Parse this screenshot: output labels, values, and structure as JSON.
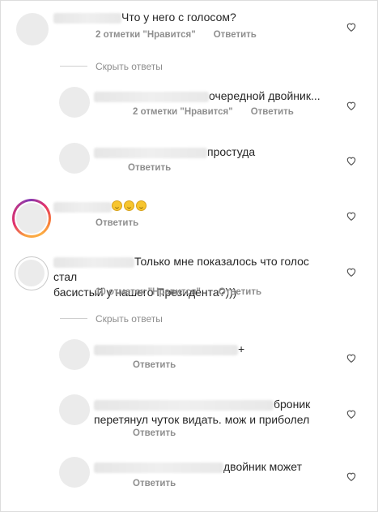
{
  "comments": [
    {
      "text": "Что у него с голосом?",
      "likes": "2 отметки \"Нравится\"",
      "reply": "Ответить"
    },
    {
      "hide_replies": "Скрыть ответы"
    },
    {
      "text": "очередной двойник...",
      "likes": "2 отметки \"Нравится\"",
      "reply": "Ответить"
    },
    {
      "text": "простуда",
      "reply": "Ответить"
    },
    {
      "emoji_count": 3,
      "reply": "Ответить"
    },
    {
      "text": "Только мне показалось что голос стал басистый у нашего Президента?)))",
      "likes": "10 отметок \"Нравится\"",
      "reply": "Ответить"
    },
    {
      "hide_replies": "Скрыть ответы"
    },
    {
      "text": "+",
      "reply": "Ответить"
    },
    {
      "text": "броник перетянул чуток видать. мож и приболел",
      "reply": "Ответить"
    },
    {
      "text": "двойник может",
      "reply": "Ответить"
    }
  ],
  "c1": {
    "text": "Что у него с голосом?",
    "likes": "2 отметки \"Нравится\"",
    "reply": "Ответить"
  },
  "h1": "Скрыть ответы",
  "c2": {
    "text": "очередной двойник...",
    "likes": "2 отметки \"Нравится\"",
    "reply": "Ответить"
  },
  "c3": {
    "text": "простуда",
    "reply": "Ответить"
  },
  "c4": {
    "reply": "Ответить"
  },
  "c5": {
    "line1": "Только мне показалось что голос стал",
    "line2": "басистый у нашего Президента?)))",
    "likes": "10 отметок \"Нравится\"",
    "reply": "Ответить"
  },
  "h2": "Скрыть ответы",
  "c6": {
    "text": "+",
    "reply": "Ответить"
  },
  "c7": {
    "line1": "броник",
    "line2": "перетянул чуток видать. мож и приболел",
    "reply": "Ответить"
  },
  "c8": {
    "text": "двойник может",
    "reply": "Ответить"
  },
  "icons": {
    "like": "heart-outline-icon",
    "emoji": "smiling-face-emoji"
  },
  "colors": {
    "muted": "#8e8e8e",
    "text": "#262626",
    "avatar_placeholder": "#ebebeb"
  }
}
